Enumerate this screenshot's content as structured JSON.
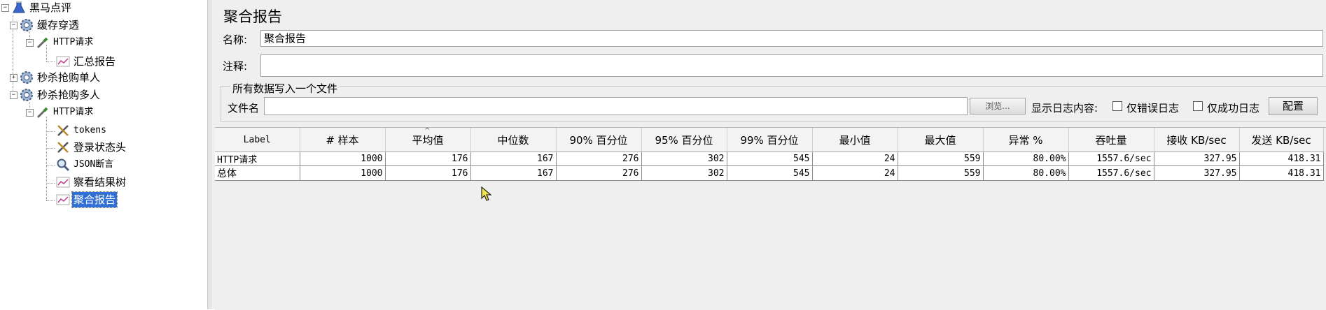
{
  "tree": {
    "root": {
      "label": "黑马点评"
    },
    "group1": {
      "label": "缓存穿透"
    },
    "group1_http": {
      "label": "HTTP请求"
    },
    "group1_report": {
      "label": "汇总报告"
    },
    "group2": {
      "label": "秒杀抢购单人"
    },
    "group3": {
      "label": "秒杀抢购多人"
    },
    "group3_http": {
      "label": "HTTP请求"
    },
    "tokens": {
      "label": "tokens"
    },
    "login_header": {
      "label": "登录状态头"
    },
    "json_assert": {
      "label": "JSON断言"
    },
    "result_tree": {
      "label": "察看结果树"
    },
    "agg_report": {
      "label": "聚合报告"
    }
  },
  "panel": {
    "title": "聚合报告",
    "name_label": "名称:",
    "name_value": "聚合报告",
    "comment_label": "注释:",
    "comment_value": "",
    "file_group_title": "所有数据写入一个文件",
    "filename_label": "文件名",
    "filename_value": "",
    "browse_button": "浏览...",
    "log_content_label": "显示日志内容:",
    "errors_only_label": "仅错误日志",
    "success_only_label": "仅成功日志",
    "configure_button": "配置"
  },
  "table": {
    "columns": [
      "Label",
      "# 样本",
      "平均值",
      "中位数",
      "90% 百分位",
      "95% 百分位",
      "99% 百分位",
      "最小值",
      "最大值",
      "异常 %",
      "吞吐量",
      "接收 KB/sec",
      "发送 KB/sec"
    ],
    "rows": [
      [
        "HTTP请求",
        "1000",
        "176",
        "167",
        "276",
        "302",
        "545",
        "24",
        "559",
        "80.00%",
        "1557.6/sec",
        "327.95",
        "418.31"
      ],
      [
        "总体",
        "1000",
        "176",
        "167",
        "276",
        "302",
        "545",
        "24",
        "559",
        "80.00%",
        "1557.6/sec",
        "327.95",
        "418.31"
      ]
    ]
  },
  "colors": {
    "selection": "#2f6fd6",
    "cursor": "#f2e34a"
  }
}
